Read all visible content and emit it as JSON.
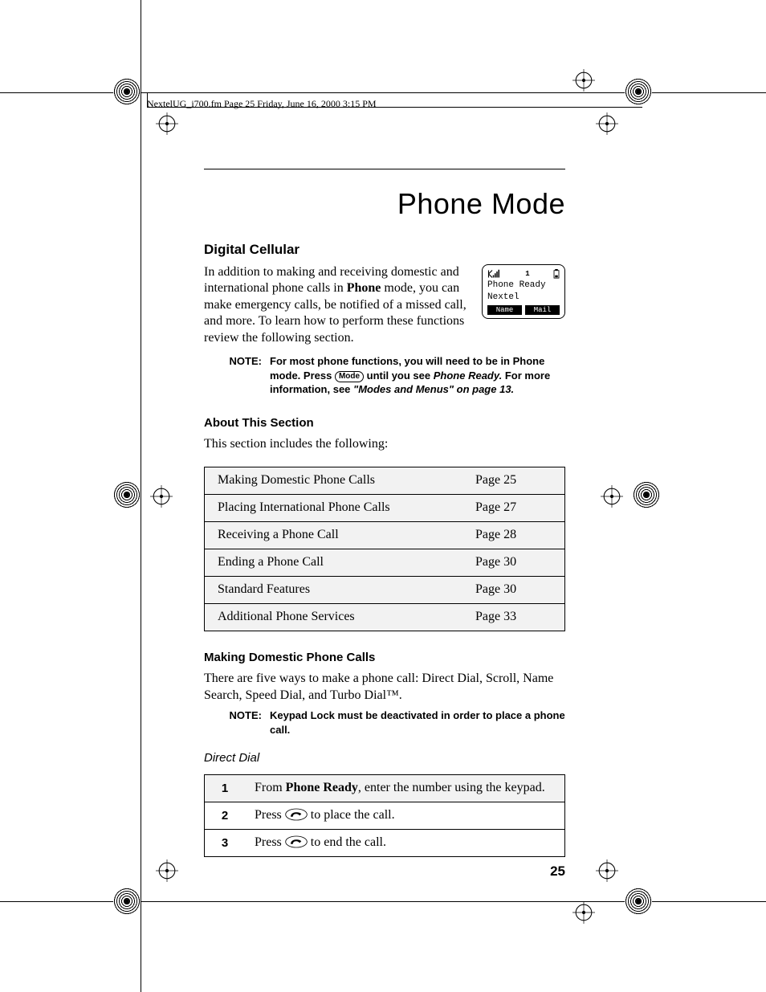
{
  "header_line": "NextelUG_i700.fm  Page 25  Friday, June 16, 2000  3:15 PM",
  "title": "Phone Mode",
  "h_digital": "Digital Cellular",
  "intro_p1a": "In addition to making and receiving domestic and international phone calls in ",
  "intro_p1_bold": "Phone",
  "intro_p1b": " mode, you can make emergency calls, be notified of a missed call, and more. To learn how to perform these functions review the following section.",
  "phone_screen": {
    "line1": "Phone Ready",
    "line2": "Nextel",
    "soft_left": "Name",
    "soft_right": "Mail",
    "indicator": "1"
  },
  "note1": {
    "label": "NOTE:",
    "line1a": "For most phone functions, you will need to be in Phone mode. Press ",
    "mode_btn": "Mode",
    "line1b": " until you see ",
    "italic1": "Phone Ready.",
    "line2a": " For more information, see ",
    "italic2": "\"Modes and Menus\" on page 13."
  },
  "h_about": "About This Section",
  "about_p": "This section includes the following:",
  "toc": [
    {
      "t": "Making Domestic Phone Calls",
      "p": "Page 25"
    },
    {
      "t": "Placing International Phone Calls",
      "p": "Page 27"
    },
    {
      "t": "Receiving a Phone Call",
      "p": "Page 28"
    },
    {
      "t": "Ending a Phone Call",
      "p": "Page 30"
    },
    {
      "t": "Standard Features",
      "p": "Page 30"
    },
    {
      "t": "Additional Phone Services",
      "p": "Page 33"
    }
  ],
  "h_making": "Making Domestic Phone Calls",
  "making_p": "There are five ways to make a phone call: Direct Dial, Scroll, Name Search, Speed Dial, and Turbo Dial™.",
  "note2": {
    "label": "NOTE:",
    "body": "Keypad Lock must be deactivated in order to place a phone call."
  },
  "h_direct": "Direct Dial",
  "steps": [
    {
      "n": "1",
      "pre": "From ",
      "bold": "Phone Ready",
      "post": ", enter the number using the keypad.",
      "icon": false
    },
    {
      "n": "2",
      "pre": "Press ",
      "bold": "",
      "post": " to place the call.",
      "icon": true
    },
    {
      "n": "3",
      "pre": "Press ",
      "bold": "",
      "post": " to end the call.",
      "icon": true
    }
  ],
  "page_num": "25"
}
